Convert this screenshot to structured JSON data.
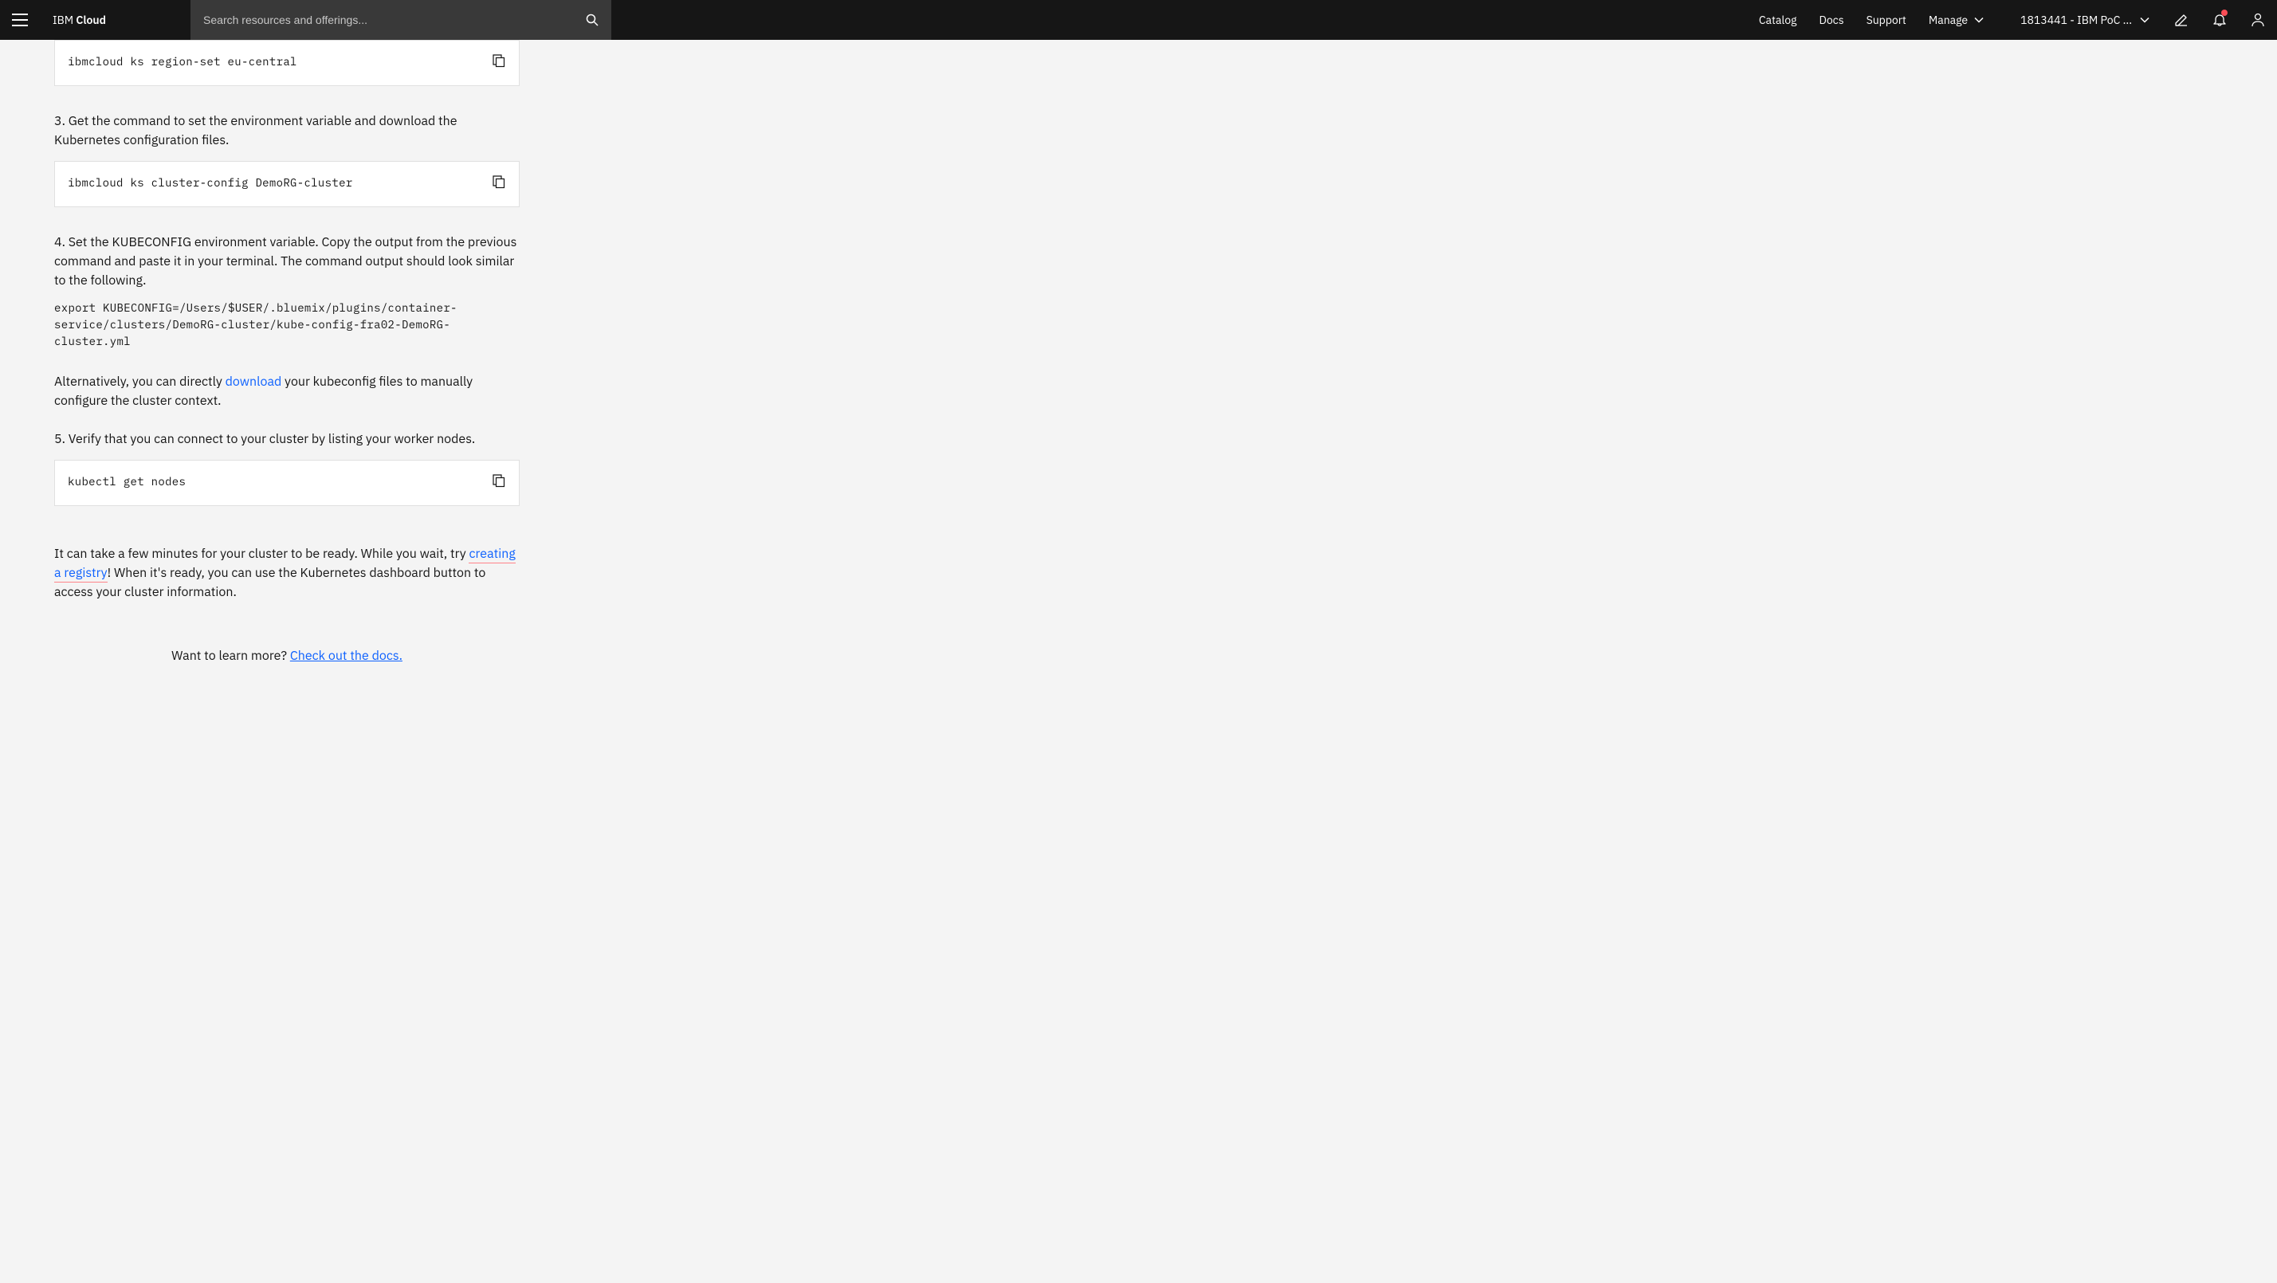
{
  "header": {
    "brand_light": "IBM ",
    "brand_bold": "Cloud",
    "search_placeholder": "Search resources and offerings...",
    "nav": {
      "catalog": "Catalog",
      "docs": "Docs",
      "support": "Support",
      "manage": "Manage"
    },
    "account": "1813441 - IBM PoC ..."
  },
  "content": {
    "code1": "ibmcloud ks region-set eu-central",
    "step3": "3. Get the command to set the environment variable and download the Kubernetes configuration files.",
    "code2": "ibmcloud ks cluster-config DemoRG-cluster",
    "step4": "4. Set the KUBECONFIG environment variable. Copy the output from the previous command and paste it in your terminal. The command output should look similar to the following.",
    "export_cmd": "export KUBECONFIG=/Users/$USER/.bluemix/plugins/container-service/clusters/DemoRG-cluster/kube-config-fra02-DemoRG-cluster.yml",
    "alt_pre": "Alternatively, you can directly ",
    "alt_link": "download",
    "alt_post": " your kubeconfig files to manually configure the cluster context.",
    "step5": "5. Verify that you can connect to your cluster by listing your worker nodes.",
    "code3": "kubectl get nodes",
    "wait_pre": "It can take a few minutes for your cluster to be ready. While you wait, try ",
    "wait_link": "creating a registry",
    "wait_post": "! When it's ready, you can use the Kubernetes dashboard button to access your cluster information.",
    "learn_pre": "Want to learn more? ",
    "learn_link": "Check out the docs."
  }
}
